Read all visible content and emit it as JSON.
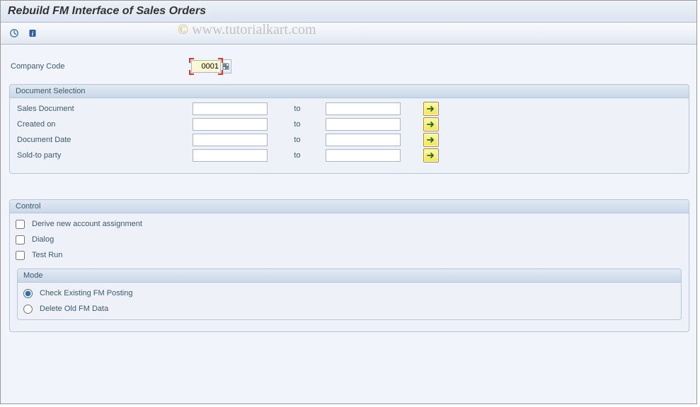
{
  "title": "Rebuild FM Interface of Sales Orders",
  "watermark": "© www.tutorialkart.com",
  "company_code": {
    "label": "Company Code",
    "value": "0001"
  },
  "doc_selection": {
    "title": "Document Selection",
    "to": "to",
    "rows": [
      {
        "label": "Sales Document",
        "from": "",
        "to": ""
      },
      {
        "label": "Created on",
        "from": "",
        "to": ""
      },
      {
        "label": "Document Date",
        "from": "",
        "to": ""
      },
      {
        "label": "Sold-to party",
        "from": "",
        "to": ""
      }
    ]
  },
  "control": {
    "title": "Control",
    "derive": "Derive new account assignment",
    "dialog": "Dialog",
    "testrun": "Test Run",
    "mode": {
      "title": "Mode",
      "check": "Check Existing FM Posting",
      "delete": "Delete Old FM Data"
    }
  }
}
